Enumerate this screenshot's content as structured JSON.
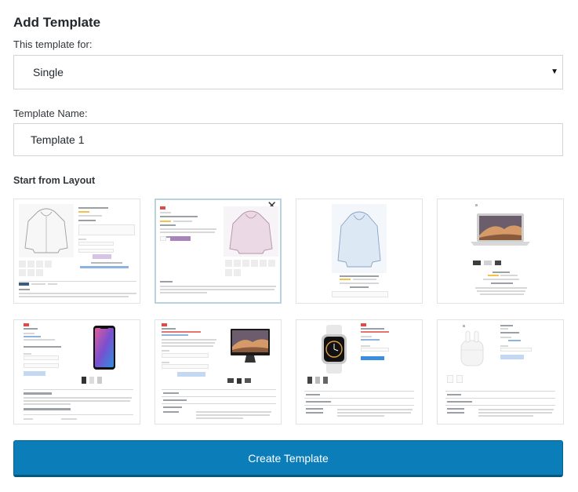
{
  "dialog": {
    "title": "Add Template",
    "template_for_label": "This template for:",
    "template_for_value": "Single",
    "template_name_label": "Template Name:",
    "template_name_value": "Template 1",
    "layout_label": "Start from Layout",
    "create_button": "Create Template"
  },
  "icons": {
    "dropdown": "dropdown-arrow-icon",
    "close": "close-icon"
  },
  "colors": {
    "primary_button": "#0b7eb9",
    "selected_border": "#b9d3dc"
  },
  "layouts": {
    "selected_index": 1,
    "items": [
      {
        "product": "hoodie"
      },
      {
        "product": "hoodie-pink"
      },
      {
        "product": "hoodie-blue"
      },
      {
        "product": "macbook"
      },
      {
        "product": "iphone"
      },
      {
        "product": "imac"
      },
      {
        "product": "apple-watch"
      },
      {
        "product": "airpods"
      }
    ]
  }
}
